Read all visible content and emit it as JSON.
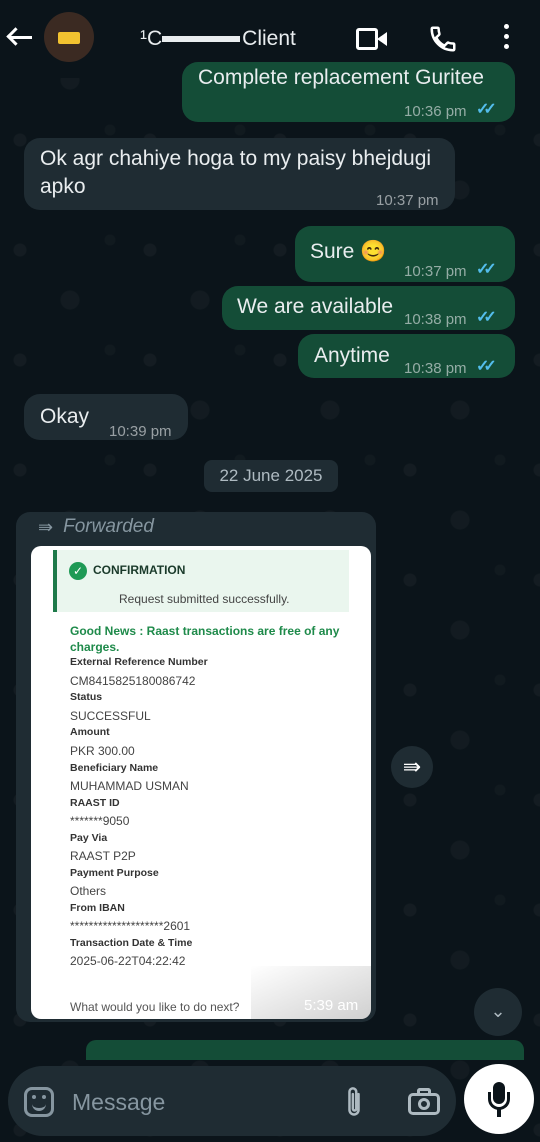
{
  "header": {
    "contact_name": "Client",
    "contact_name_prefix": "¹C"
  },
  "messages": [
    {
      "id": "m0",
      "dir": "out",
      "text": "Complete replacement Guritee",
      "time": "10:36 pm",
      "ticks": "read"
    },
    {
      "id": "m1",
      "dir": "in",
      "text": "Ok agr chahiye hoga to my paisy bhejdugi apko",
      "time": "10:37 pm"
    },
    {
      "id": "m2",
      "dir": "out",
      "text": "Sure 😊",
      "time": "10:37 pm",
      "ticks": "read"
    },
    {
      "id": "m3",
      "dir": "out",
      "text": "We are available",
      "time": "10:38 pm",
      "ticks": "read"
    },
    {
      "id": "m4",
      "dir": "out",
      "text": "Anytime",
      "time": "10:38 pm",
      "ticks": "read"
    },
    {
      "id": "m5",
      "dir": "in",
      "text": "Okay",
      "time": "10:39 pm"
    }
  ],
  "date_chip": "22 June 2025",
  "forwarded": {
    "label": "Forwarded",
    "time": "5:39 am",
    "receipt": {
      "title": "CONFIRMATION",
      "subtitle": "Request submitted successfully.",
      "good_news": "Good News : Raast transactions are free of any charges.",
      "fields": [
        {
          "label": "External Reference Number",
          "value": "CM8415825180086742"
        },
        {
          "label": "Status",
          "value": "SUCCESSFUL"
        },
        {
          "label": "Amount",
          "value": "PKR 300.00"
        },
        {
          "label": "Beneficiary Name",
          "value": "MUHAMMAD USMAN"
        },
        {
          "label": "RAAST ID",
          "value": "*******9050"
        },
        {
          "label": "Pay Via",
          "value": "RAAST P2P"
        },
        {
          "label": "Payment Purpose",
          "value": "Others"
        },
        {
          "label": "From IBAN",
          "value": "********************2601"
        },
        {
          "label": "Transaction Date & Time",
          "value": "2025-06-22T04:22:42"
        }
      ],
      "next_prompt": "What would you like to do next?"
    }
  },
  "composer": {
    "placeholder": "Message"
  },
  "icons": {
    "tick": "double-check-icon",
    "colors": {
      "outgoing": "#144d37",
      "incoming": "#1f2c33",
      "read_ticks": "#53bdeb"
    }
  }
}
